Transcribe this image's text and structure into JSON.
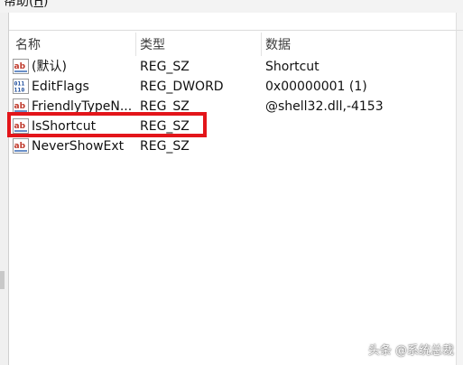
{
  "menu": {
    "help_label": "帮助(",
    "help_accel": "H",
    "help_close": ")"
  },
  "columns": {
    "name": "名称",
    "type": "类型",
    "data": "数据"
  },
  "rows": [
    {
      "icon": "string-value-icon",
      "name": "(默认)",
      "type": "REG_SZ",
      "data": "Shortcut"
    },
    {
      "icon": "binary-value-icon",
      "name": "EditFlags",
      "type": "REG_DWORD",
      "data": "0x00000001 (1)"
    },
    {
      "icon": "string-value-icon",
      "name": "FriendlyTypeN...",
      "type": "REG_SZ",
      "data": "@shell32.dll,-4153"
    },
    {
      "icon": "string-value-icon",
      "name": "IsShortcut",
      "type": "REG_SZ",
      "data": ""
    },
    {
      "icon": "string-value-icon",
      "name": "NeverShowExt",
      "type": "REG_SZ",
      "data": ""
    }
  ],
  "highlight": {
    "color": "#e3151a",
    "row": "IsShortcut"
  },
  "watermark": "头条 @系统总裁"
}
